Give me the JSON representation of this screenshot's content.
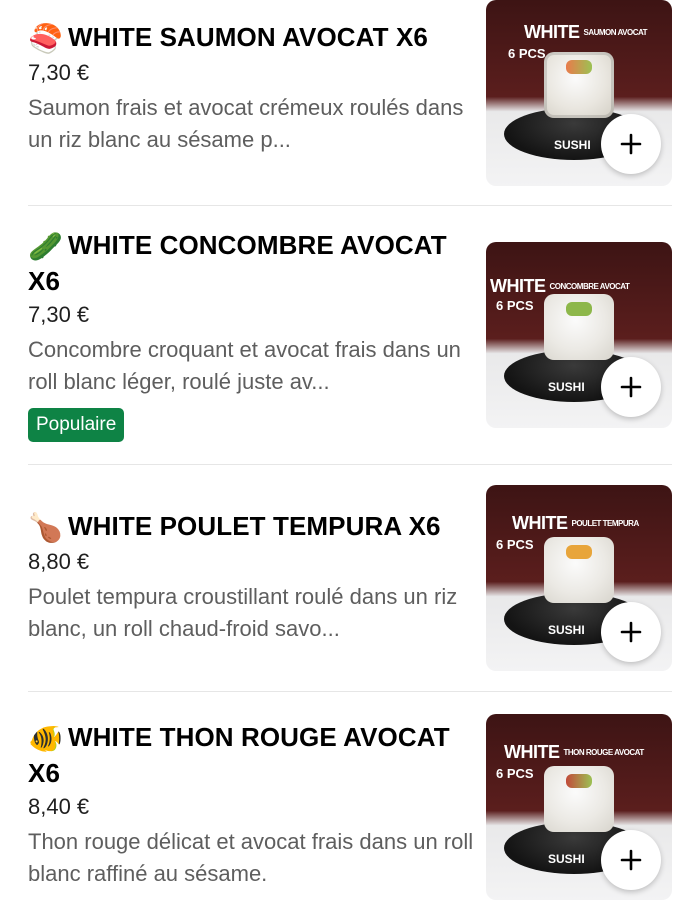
{
  "items": [
    {
      "emoji": "🍣",
      "name": "WHITE SAUMON AVOCAT X6",
      "price": "7,30 €",
      "description": "Saumon frais et avocat crémeux roulés dans un riz blanc au sésame p...",
      "badge": "",
      "image": {
        "headline": "WHITE",
        "subtitle": "SAUMON AVOCAT",
        "pcs": "6 PCS",
        "plate": "SUSHI"
      },
      "add_icon": "plus-icon"
    },
    {
      "emoji": "🥒",
      "name": "WHITE CONCOMBRE AVOCAT X6",
      "price": "7,30 €",
      "description": "Concombre croquant et avocat frais dans un roll blanc léger, roulé juste av...",
      "badge": "Populaire",
      "image": {
        "headline": "WHITE",
        "subtitle": "CONCOMBRE AVOCAT",
        "pcs": "6 PCS",
        "plate": "SUSHI"
      },
      "add_icon": "plus-icon"
    },
    {
      "emoji": "🍗",
      "name": "WHITE POULET TEMPURA X6",
      "price": "8,80 €",
      "description": "Poulet tempura croustillant roulé dans un riz blanc, un roll chaud-froid savo...",
      "badge": "",
      "image": {
        "headline": "WHITE",
        "subtitle": "POULET TEMPURA",
        "pcs": "6 PCS",
        "plate": "SUSHI"
      },
      "add_icon": "plus-icon"
    },
    {
      "emoji": "🐠",
      "name": "WHITE THON ROUGE AVOCAT X6",
      "price": "8,40 €",
      "description": "Thon rouge délicat et avocat frais dans un roll blanc raffiné au sésame.",
      "badge": "",
      "image": {
        "headline": "WHITE",
        "subtitle": "THON ROUGE AVOCAT",
        "pcs": "6 PCS",
        "plate": "SUSHI"
      },
      "add_icon": "plus-icon"
    }
  ],
  "colors": {
    "badge_bg": "#0e8345",
    "text": "#000000",
    "description": "#5e5e5e",
    "thumb_bg": "#4a1818"
  }
}
